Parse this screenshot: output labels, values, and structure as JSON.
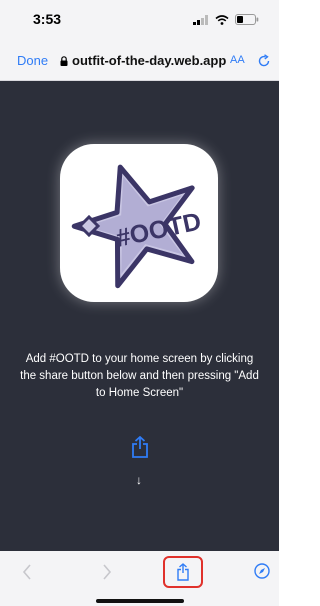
{
  "status_bar": {
    "time": "3:53"
  },
  "browser": {
    "done_label": "Done",
    "url": "outfit-of-the-day.web.app",
    "text_size_label": "AA"
  },
  "page": {
    "app_icon_text": "#OOTD",
    "instructions": "Add #OOTD to your home screen by clicking the share button below and then pressing \"Add to Home Screen\""
  },
  "colors": {
    "accent": "#2f7cf6",
    "page_background": "#2c2f3a",
    "highlight": "#e0312b",
    "star_fill": "#c9c6e3",
    "star_outline": "#3b3566"
  },
  "icons": [
    "signal-icon",
    "wifi-icon",
    "battery-icon",
    "lock-icon",
    "reload-icon",
    "share-icon",
    "down-arrow-icon",
    "back-icon",
    "forward-icon",
    "compass-icon"
  ]
}
